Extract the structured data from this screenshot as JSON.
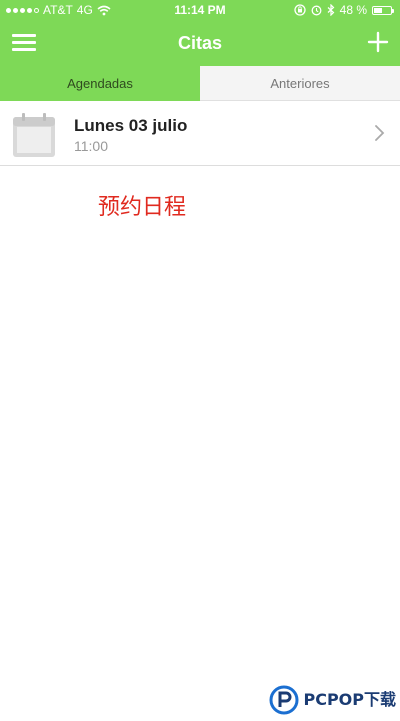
{
  "status_bar": {
    "carrier": "AT&T",
    "network": "4G",
    "time": "11:14 PM",
    "battery_text": "48 %",
    "battery_level": 0.48,
    "signal_bars_filled": 4,
    "signal_bars_total": 5
  },
  "nav": {
    "title": "Citas",
    "menu_icon": "hamburger-menu-icon",
    "add_icon": "plus-icon"
  },
  "tabs": [
    {
      "label": "Agendadas",
      "active": true
    },
    {
      "label": "Anteriores",
      "active": false
    }
  ],
  "appointments": [
    {
      "title": "Lunes 03 julio",
      "time": "11:00",
      "icon": "calendar-icon"
    }
  ],
  "caption": "预约日程",
  "watermark": {
    "text": "PCPOP下载"
  },
  "colors": {
    "brand_green": "#7ed957",
    "caption_red": "#e02a1f",
    "tab_inactive_bg": "#f4f4f4"
  }
}
